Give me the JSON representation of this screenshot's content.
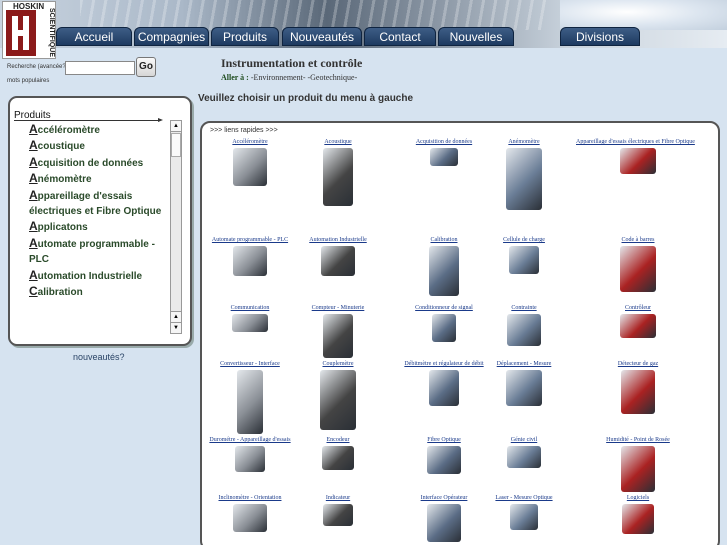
{
  "header": {
    "logo_line1": "HOSKIN",
    "logo_line2": "SCIENTIFIQUE",
    "tabs": [
      "Accueil",
      "Compagnies",
      "Produits",
      "Nouveautés",
      "Contact",
      "Nouvelles",
      "Divisions"
    ]
  },
  "search": {
    "label": "Recherche (avancée?)",
    "value": "",
    "go_label": "Go",
    "popular_label": "mots populaires"
  },
  "products_panel": {
    "title": "Produits",
    "items": [
      {
        "cap": "A",
        "rest": "ccéléromètre"
      },
      {
        "cap": "A",
        "rest": "coustique"
      },
      {
        "cap": "A",
        "rest": "cquisition de données"
      },
      {
        "cap": "A",
        "rest": "némomètre"
      },
      {
        "cap": "A",
        "rest": "ppareillage d'essais électriques et Fibre Optique"
      },
      {
        "cap": "A",
        "rest": "pplicatons"
      },
      {
        "cap": "A",
        "rest": "utomate programmable - PLC"
      },
      {
        "cap": "A",
        "rest": "utomation Industrielle"
      },
      {
        "cap": "C",
        "rest": "alibration"
      }
    ],
    "nouveautes_link": "nouveautés?"
  },
  "main": {
    "title": "Instrumentation et contrôle",
    "goto_label": "Aller à :",
    "goto_links": "-Environnement- -Geotechnique-",
    "instruction": "Veuillez choisir un produit du menu à gauche",
    "quick_links": ">>> liens rapides >>>",
    "categories": [
      "Accéléromètre",
      "Acoustique",
      "Acquisition de données",
      "Anémomètre",
      "Appareillage d'essais électriques et Fibre Optique",
      "Automate programmable - PLC",
      "Automation Industrielle",
      "Calibration",
      "Cellule de charge",
      "Code à barres",
      "Communication",
      "Compteur - Minuterie",
      "Conditionneur de signal",
      "Contrainte",
      "Contrôleur",
      "Convertisseur - Interface",
      "Couplemètre",
      "Débitmètre et régulateur de débit",
      "Déplacement - Mesure",
      "Détecteur de gaz",
      "Durométre - Appareillage d'essais",
      "Encodeur",
      "Fibre Optique",
      "Génie civil",
      "Humidité - Point de Rosée",
      "Inclinomètre - Orientation",
      "Indicateur",
      "Interface Opérateur",
      "Laser - Mesure Optique",
      "Logiciels"
    ]
  },
  "colors": {
    "page_bg": "#d6e3f0",
    "tab_bg": "#2a4a74",
    "link": "#1a3a8a"
  }
}
